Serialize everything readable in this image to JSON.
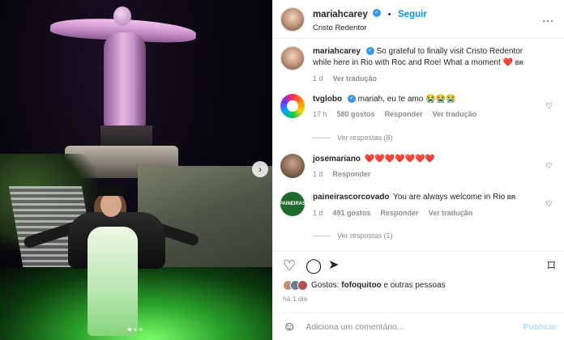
{
  "header": {
    "username": "mariahcarey",
    "follow_label": "Seguir",
    "separator": "•",
    "location": "Cristo Redentor",
    "more_label": "..."
  },
  "caption": {
    "username": "mariahcarey",
    "text": "So grateful to finally visit Cristo Redentor while here in Rio with Roc and Roe! What a moment",
    "emoji": "❤️",
    "region": "BR",
    "time": "1 d",
    "translate_label": "Ver tradução"
  },
  "comments": [
    {
      "username": "tvglobo",
      "verified": true,
      "text": "mariah, eu te amo",
      "emoji": "😭😭😭",
      "time": "17 h",
      "likes": "580 gostos",
      "reply_label": "Responder",
      "translate_label": "Ver tradução",
      "replies_label": "Ver respostas (8)"
    },
    {
      "username": "josemariano",
      "text": "",
      "emoji": "❤️❤️❤️❤️❤️❤️❤️",
      "time": "1 d",
      "reply_label": "Responder"
    },
    {
      "username": "paineirascorcovado",
      "text": "You are always welcome in Rio",
      "region": "BR",
      "time": "1 d",
      "likes": "491 gostos",
      "reply_label": "Responder",
      "translate_label": "Ver tradução",
      "replies_label": "Ver respostas (1)",
      "avatar_text": "PAINEIRAS"
    }
  ],
  "actions": {
    "like_icon": "heart-outline-icon",
    "comment_icon": "comment-icon",
    "share_icon": "send-icon",
    "save_icon": "bookmark-icon"
  },
  "likes": {
    "prefix": "Gostos: ",
    "user": "fofoquitoo",
    "suffix": " e outras pessoas"
  },
  "posted_ago": "há 1 dia",
  "composer": {
    "placeholder": "Adiciona um comentário...",
    "publish_label": "Publicar"
  },
  "colors": {
    "accent": "#0095f6",
    "verified": "#3897f0",
    "heart_red": "#ed4956",
    "muted": "#8e8e8e"
  }
}
